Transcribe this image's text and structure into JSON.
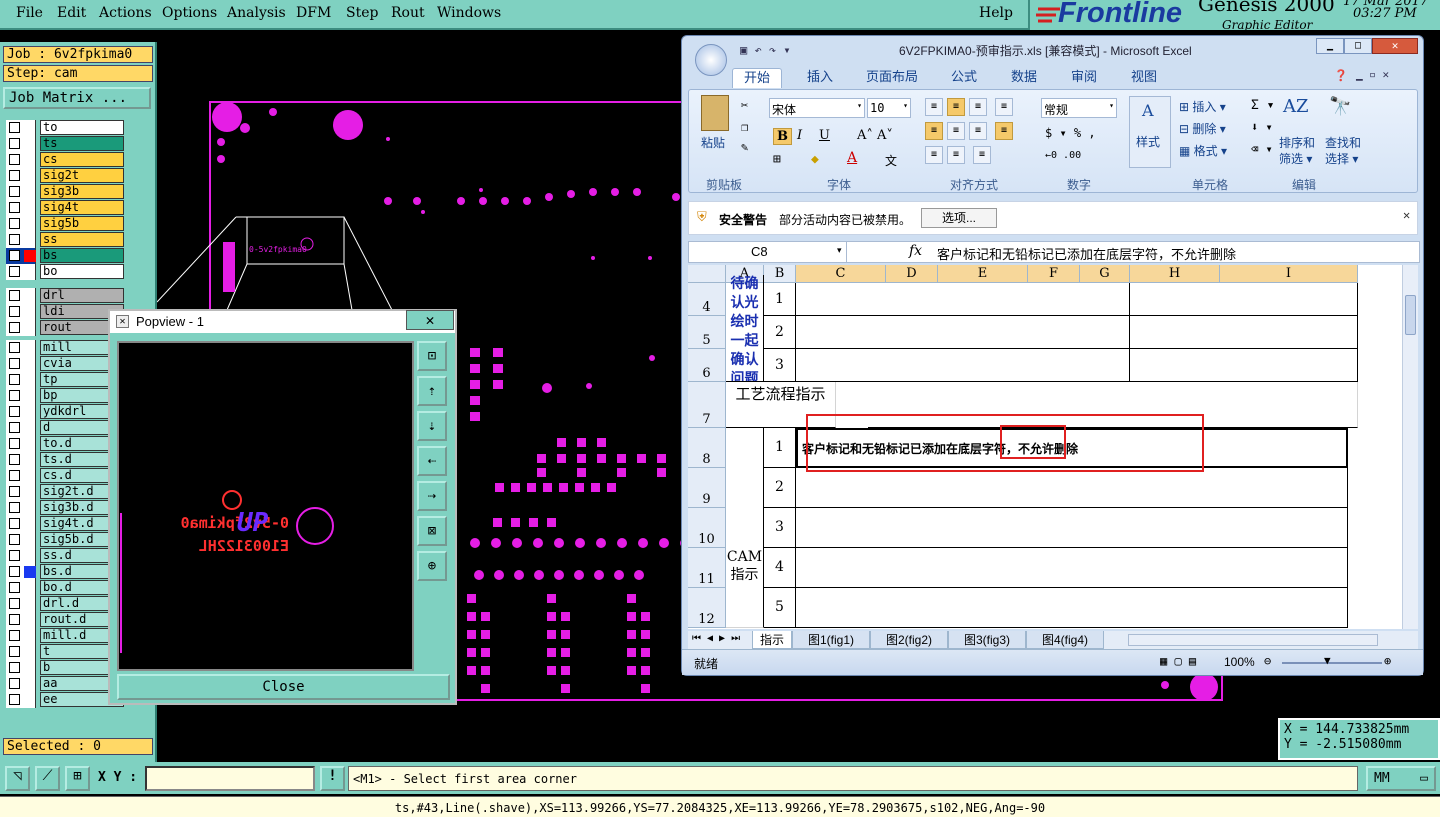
{
  "menu": [
    "File",
    "Edit",
    "Actions",
    "Options",
    "Analysis",
    "DFM",
    "Step",
    "Rout",
    "Windows"
  ],
  "help_label": "Help",
  "brand": {
    "name": "Frontline",
    "product": "Genesis 2000",
    "subtitle": "Graphic Editor",
    "date": "17 Mar 2017",
    "time": "03:27 PM"
  },
  "job": {
    "job_label": "Job : 6v2fpkima0",
    "step_label": "Step: cam",
    "matrix_button": "Job Matrix ..."
  },
  "layers_top": [
    {
      "name": "to",
      "color": "#ffffff"
    },
    {
      "name": "ts",
      "color": "#1a9a7a"
    },
    {
      "name": "cs",
      "color": "#ffd040"
    },
    {
      "name": "sig2t",
      "color": "#ffd040"
    },
    {
      "name": "sig3b",
      "color": "#ffd040"
    },
    {
      "name": "sig4t",
      "color": "#ffd040"
    },
    {
      "name": "sig5b",
      "color": "#ffd040"
    },
    {
      "name": "ss",
      "color": "#ffd040"
    },
    {
      "name": "bs",
      "color": "#1a9a7a"
    },
    {
      "name": "bo",
      "color": "#ffffff"
    }
  ],
  "layers_drill": [
    {
      "name": "drl",
      "color": "#b0b0b0"
    },
    {
      "name": "ldi",
      "color": "#b0b0b0"
    },
    {
      "name": "rout",
      "color": "#b0b0b0"
    }
  ],
  "layers_misc": [
    "mill",
    "cvia",
    "tp",
    "bp",
    "ydkdrl",
    "d",
    "to.d",
    "ts.d",
    "cs.d",
    "sig2t.d",
    "sig3b.d",
    "sig4t.d",
    "sig5b.d",
    "ss.d",
    "bs.d",
    "bo.d",
    "drl.d",
    "rout.d",
    "mill.d",
    "t",
    "b",
    "aa",
    "ee"
  ],
  "selected_label": "Selected : 0",
  "coords": {
    "x": "X  =  144.733825mm",
    "y": "Y  =  -2.515080mm"
  },
  "cmd": {
    "xy_label": "X Y :",
    "prompt": "<M1> - Select first area corner",
    "units": "MM"
  },
  "status_text": "ts,#43,Line(.shave),XS=113.99266,YS=77.2084325,XE=113.99266,YE=78.2903675,s102,NEG,Ang=-90",
  "popview": {
    "title": "Popview - 1",
    "close_label": "Close",
    "silk_text_1": "0-5v2fpkima0",
    "silk_text_2": "E1003122HL"
  },
  "excel": {
    "title": "6V2FPKIMA0-预审指示.xls [兼容模式] - Microsoft Excel",
    "tabs": [
      "开始",
      "插入",
      "页面布局",
      "公式",
      "数据",
      "审阅",
      "视图"
    ],
    "clipboard": {
      "paste": "粘贴",
      "group": "剪贴板"
    },
    "font": {
      "name": "宋体",
      "size": "10",
      "group": "字体"
    },
    "align": {
      "group": "对齐方式"
    },
    "number": {
      "format": "常规",
      "group": "数字"
    },
    "styles": {
      "label": "样式"
    },
    "cells": {
      "insert": "插入",
      "delete": "删除",
      "format": "格式",
      "group": "单元格"
    },
    "editing": {
      "sort": "排序和",
      "filter": "筛选",
      "find": "查找和",
      "select": "选择",
      "group": "编辑"
    },
    "security": {
      "label": "安全警告",
      "message": "部分活动内容已被禁用。",
      "options": "选项..."
    },
    "namebox": "C8",
    "formula": "客户标记和无铅标记已添加在底层字符，不允许删除",
    "columns": [
      "A",
      "B",
      "C",
      "D",
      "E",
      "F",
      "G",
      "H",
      "I"
    ],
    "rows": [
      "4",
      "5",
      "6",
      "7",
      "8",
      "9",
      "10",
      "11",
      "12"
    ],
    "a_confirm": "待确认光绘时一起确认问题",
    "a_process": "工艺流程指示",
    "a_cam": "CAM指示",
    "b_vals": [
      "1",
      "2",
      "3",
      "1",
      "2",
      "3",
      "4",
      "5"
    ],
    "c8_text": "客户标记和无铅标记已添加在底层字符，不允许删除",
    "sheets": [
      "指示",
      "图1(fig1)",
      "图2(fig2)",
      "图3(fig3)",
      "图4(fig4)"
    ],
    "status": "就绪",
    "zoom": "100%"
  }
}
